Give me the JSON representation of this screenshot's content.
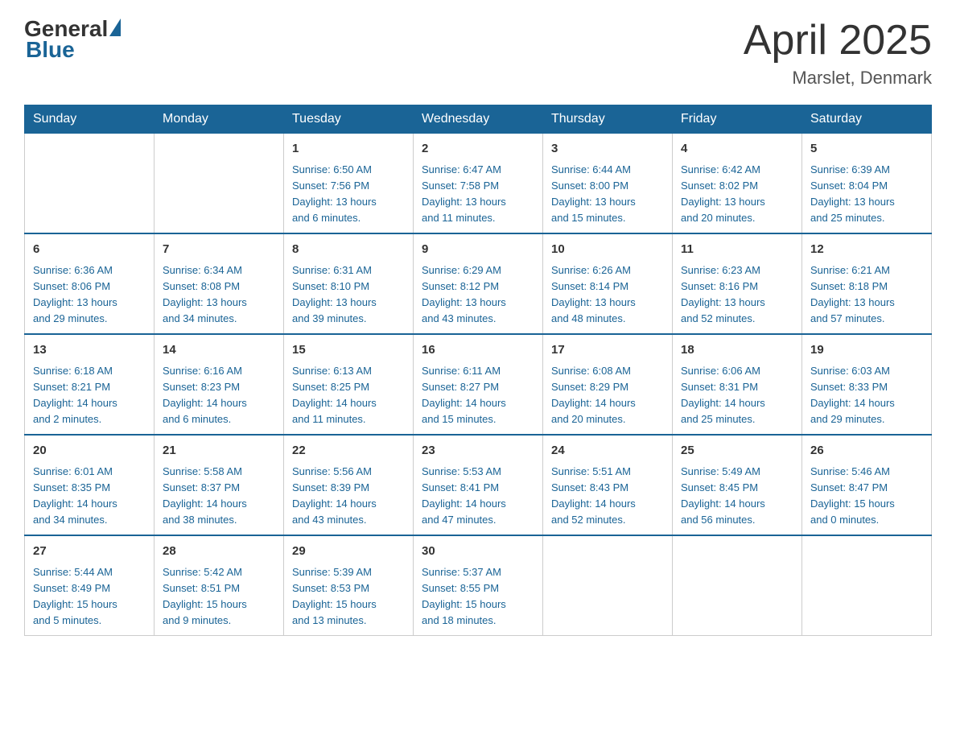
{
  "header": {
    "logo": {
      "general": "General",
      "blue": "Blue"
    },
    "title": "April 2025",
    "location": "Marslet, Denmark"
  },
  "weekdays": [
    "Sunday",
    "Monday",
    "Tuesday",
    "Wednesday",
    "Thursday",
    "Friday",
    "Saturday"
  ],
  "weeks": [
    [
      {
        "day": "",
        "info": ""
      },
      {
        "day": "",
        "info": ""
      },
      {
        "day": "1",
        "info": "Sunrise: 6:50 AM\nSunset: 7:56 PM\nDaylight: 13 hours\nand 6 minutes."
      },
      {
        "day": "2",
        "info": "Sunrise: 6:47 AM\nSunset: 7:58 PM\nDaylight: 13 hours\nand 11 minutes."
      },
      {
        "day": "3",
        "info": "Sunrise: 6:44 AM\nSunset: 8:00 PM\nDaylight: 13 hours\nand 15 minutes."
      },
      {
        "day": "4",
        "info": "Sunrise: 6:42 AM\nSunset: 8:02 PM\nDaylight: 13 hours\nand 20 minutes."
      },
      {
        "day": "5",
        "info": "Sunrise: 6:39 AM\nSunset: 8:04 PM\nDaylight: 13 hours\nand 25 minutes."
      }
    ],
    [
      {
        "day": "6",
        "info": "Sunrise: 6:36 AM\nSunset: 8:06 PM\nDaylight: 13 hours\nand 29 minutes."
      },
      {
        "day": "7",
        "info": "Sunrise: 6:34 AM\nSunset: 8:08 PM\nDaylight: 13 hours\nand 34 minutes."
      },
      {
        "day": "8",
        "info": "Sunrise: 6:31 AM\nSunset: 8:10 PM\nDaylight: 13 hours\nand 39 minutes."
      },
      {
        "day": "9",
        "info": "Sunrise: 6:29 AM\nSunset: 8:12 PM\nDaylight: 13 hours\nand 43 minutes."
      },
      {
        "day": "10",
        "info": "Sunrise: 6:26 AM\nSunset: 8:14 PM\nDaylight: 13 hours\nand 48 minutes."
      },
      {
        "day": "11",
        "info": "Sunrise: 6:23 AM\nSunset: 8:16 PM\nDaylight: 13 hours\nand 52 minutes."
      },
      {
        "day": "12",
        "info": "Sunrise: 6:21 AM\nSunset: 8:18 PM\nDaylight: 13 hours\nand 57 minutes."
      }
    ],
    [
      {
        "day": "13",
        "info": "Sunrise: 6:18 AM\nSunset: 8:21 PM\nDaylight: 14 hours\nand 2 minutes."
      },
      {
        "day": "14",
        "info": "Sunrise: 6:16 AM\nSunset: 8:23 PM\nDaylight: 14 hours\nand 6 minutes."
      },
      {
        "day": "15",
        "info": "Sunrise: 6:13 AM\nSunset: 8:25 PM\nDaylight: 14 hours\nand 11 minutes."
      },
      {
        "day": "16",
        "info": "Sunrise: 6:11 AM\nSunset: 8:27 PM\nDaylight: 14 hours\nand 15 minutes."
      },
      {
        "day": "17",
        "info": "Sunrise: 6:08 AM\nSunset: 8:29 PM\nDaylight: 14 hours\nand 20 minutes."
      },
      {
        "day": "18",
        "info": "Sunrise: 6:06 AM\nSunset: 8:31 PM\nDaylight: 14 hours\nand 25 minutes."
      },
      {
        "day": "19",
        "info": "Sunrise: 6:03 AM\nSunset: 8:33 PM\nDaylight: 14 hours\nand 29 minutes."
      }
    ],
    [
      {
        "day": "20",
        "info": "Sunrise: 6:01 AM\nSunset: 8:35 PM\nDaylight: 14 hours\nand 34 minutes."
      },
      {
        "day": "21",
        "info": "Sunrise: 5:58 AM\nSunset: 8:37 PM\nDaylight: 14 hours\nand 38 minutes."
      },
      {
        "day": "22",
        "info": "Sunrise: 5:56 AM\nSunset: 8:39 PM\nDaylight: 14 hours\nand 43 minutes."
      },
      {
        "day": "23",
        "info": "Sunrise: 5:53 AM\nSunset: 8:41 PM\nDaylight: 14 hours\nand 47 minutes."
      },
      {
        "day": "24",
        "info": "Sunrise: 5:51 AM\nSunset: 8:43 PM\nDaylight: 14 hours\nand 52 minutes."
      },
      {
        "day": "25",
        "info": "Sunrise: 5:49 AM\nSunset: 8:45 PM\nDaylight: 14 hours\nand 56 minutes."
      },
      {
        "day": "26",
        "info": "Sunrise: 5:46 AM\nSunset: 8:47 PM\nDaylight: 15 hours\nand 0 minutes."
      }
    ],
    [
      {
        "day": "27",
        "info": "Sunrise: 5:44 AM\nSunset: 8:49 PM\nDaylight: 15 hours\nand 5 minutes."
      },
      {
        "day": "28",
        "info": "Sunrise: 5:42 AM\nSunset: 8:51 PM\nDaylight: 15 hours\nand 9 minutes."
      },
      {
        "day": "29",
        "info": "Sunrise: 5:39 AM\nSunset: 8:53 PM\nDaylight: 15 hours\nand 13 minutes."
      },
      {
        "day": "30",
        "info": "Sunrise: 5:37 AM\nSunset: 8:55 PM\nDaylight: 15 hours\nand 18 minutes."
      },
      {
        "day": "",
        "info": ""
      },
      {
        "day": "",
        "info": ""
      },
      {
        "day": "",
        "info": ""
      }
    ]
  ]
}
